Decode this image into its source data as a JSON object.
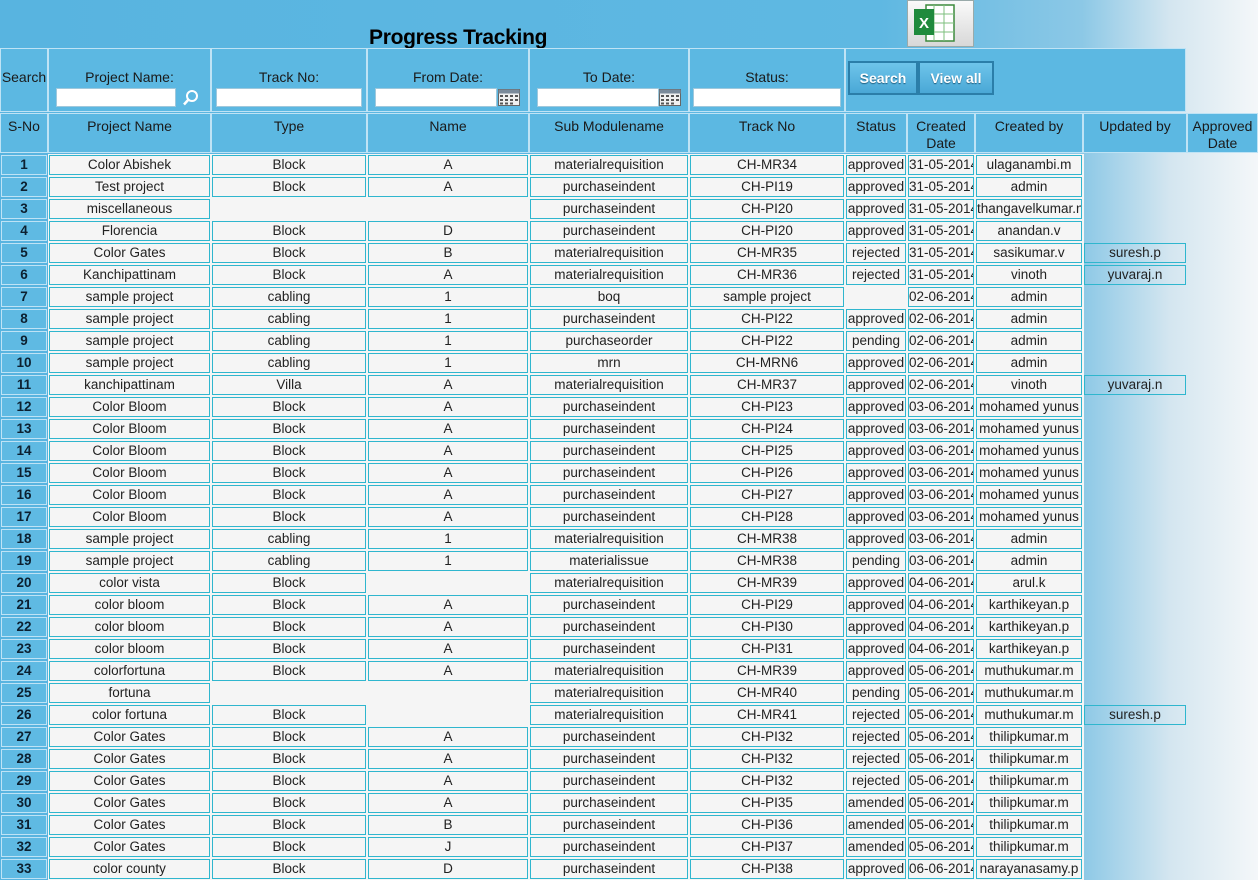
{
  "title": "Progress Tracking",
  "excel_icon": "excel-export-icon",
  "search": {
    "label": "Search",
    "project_name_label": "Project Name:",
    "track_no_label": "Track No:",
    "from_date_label": "From Date:",
    "to_date_label": "To Date:",
    "status_label": "Status:",
    "search_button": "Search",
    "view_all_button": "View all",
    "project_name_value": "",
    "track_no_value": "",
    "from_date_value": "",
    "to_date_value": "",
    "status_value": ""
  },
  "columns": [
    "S-No",
    "Project Name",
    "Type",
    "Name",
    "Sub Modulename",
    "Track No",
    "Status",
    "Created Date",
    "Created by",
    "Updated by",
    "Approved Date"
  ],
  "rows": [
    [
      "1",
      "Color Abishek",
      "Block",
      "A",
      "materialrequisition",
      "CH-MR34",
      "approved",
      "31-05-2014",
      "ulaganambi.m",
      ""
    ],
    [
      "2",
      "Test project",
      "Block",
      "A",
      "purchaseindent",
      "CH-PI19",
      "approved",
      "31-05-2014",
      "admin",
      ""
    ],
    [
      "3",
      "miscellaneous",
      "",
      "",
      "purchaseindent",
      "CH-PI20",
      "approved",
      "31-05-2014",
      "thangavelkumar.n",
      ""
    ],
    [
      "4",
      "Florencia",
      "Block",
      "D",
      "purchaseindent",
      "CH-PI20",
      "approved",
      "31-05-2014",
      "anandan.v",
      ""
    ],
    [
      "5",
      "Color Gates",
      "Block",
      "B",
      "materialrequisition",
      "CH-MR35",
      "rejected",
      "31-05-2014",
      "sasikumar.v",
      "suresh.p"
    ],
    [
      "6",
      "Kanchipattinam",
      "Block",
      "A",
      "materialrequisition",
      "CH-MR36",
      "rejected",
      "31-05-2014",
      "vinoth",
      "yuvaraj.n"
    ],
    [
      "7",
      "sample project",
      "cabling",
      "1",
      "boq",
      "sample project",
      "",
      "02-06-2014",
      "admin",
      ""
    ],
    [
      "8",
      "sample project",
      "cabling",
      "1",
      "purchaseindent",
      "CH-PI22",
      "approved",
      "02-06-2014",
      "admin",
      ""
    ],
    [
      "9",
      "sample project",
      "cabling",
      "1",
      "purchaseorder",
      "CH-PI22",
      "pending",
      "02-06-2014",
      "admin",
      ""
    ],
    [
      "10",
      "sample project",
      "cabling",
      "1",
      "mrn",
      "CH-MRN6",
      "approved",
      "02-06-2014",
      "admin",
      ""
    ],
    [
      "11",
      "kanchipattinam",
      "Villa",
      "A",
      "materialrequisition",
      "CH-MR37",
      "approved",
      "02-06-2014",
      "vinoth",
      "yuvaraj.n"
    ],
    [
      "12",
      "Color Bloom",
      "Block",
      "A",
      "purchaseindent",
      "CH-PI23",
      "approved",
      "03-06-2014",
      "mohamed yunus",
      ""
    ],
    [
      "13",
      "Color Bloom",
      "Block",
      "A",
      "purchaseindent",
      "CH-PI24",
      "approved",
      "03-06-2014",
      "mohamed yunus",
      ""
    ],
    [
      "14",
      "Color Bloom",
      "Block",
      "A",
      "purchaseindent",
      "CH-PI25",
      "approved",
      "03-06-2014",
      "mohamed yunus",
      ""
    ],
    [
      "15",
      "Color Bloom",
      "Block",
      "A",
      "purchaseindent",
      "CH-PI26",
      "approved",
      "03-06-2014",
      "mohamed yunus",
      ""
    ],
    [
      "16",
      "Color Bloom",
      "Block",
      "A",
      "purchaseindent",
      "CH-PI27",
      "approved",
      "03-06-2014",
      "mohamed yunus",
      ""
    ],
    [
      "17",
      "Color Bloom",
      "Block",
      "A",
      "purchaseindent",
      "CH-PI28",
      "approved",
      "03-06-2014",
      "mohamed yunus",
      ""
    ],
    [
      "18",
      "sample project",
      "cabling",
      "1",
      "materialrequisition",
      "CH-MR38",
      "approved",
      "03-06-2014",
      "admin",
      ""
    ],
    [
      "19",
      "sample project",
      "cabling",
      "1",
      "materialissue",
      "CH-MR38",
      "pending",
      "03-06-2014",
      "admin",
      ""
    ],
    [
      "20",
      "color vista",
      "Block",
      "",
      "materialrequisition",
      "CH-MR39",
      "approved",
      "04-06-2014",
      "arul.k",
      ""
    ],
    [
      "21",
      "color bloom",
      "Block",
      "A",
      "purchaseindent",
      "CH-PI29",
      "approved",
      "04-06-2014",
      "karthikeyan.p",
      ""
    ],
    [
      "22",
      "color bloom",
      "Block",
      "A",
      "purchaseindent",
      "CH-PI30",
      "approved",
      "04-06-2014",
      "karthikeyan.p",
      ""
    ],
    [
      "23",
      "color bloom",
      "Block",
      "A",
      "purchaseindent",
      "CH-PI31",
      "approved",
      "04-06-2014",
      "karthikeyan.p",
      ""
    ],
    [
      "24",
      "colorfortuna",
      "Block",
      "A",
      "materialrequisition",
      "CH-MR39",
      "approved",
      "05-06-2014",
      "muthukumar.m",
      ""
    ],
    [
      "25",
      "fortuna",
      "",
      "",
      "materialrequisition",
      "CH-MR40",
      "pending",
      "05-06-2014",
      "muthukumar.m",
      ""
    ],
    [
      "26",
      "color fortuna",
      "Block",
      "",
      "materialrequisition",
      "CH-MR41",
      "rejected",
      "05-06-2014",
      "muthukumar.m",
      "suresh.p"
    ],
    [
      "27",
      "Color Gates",
      "Block",
      "A",
      "purchaseindent",
      "CH-PI32",
      "rejected",
      "05-06-2014",
      "thilipkumar.m",
      ""
    ],
    [
      "28",
      "Color Gates",
      "Block",
      "A",
      "purchaseindent",
      "CH-PI32",
      "rejected",
      "05-06-2014",
      "thilipkumar.m",
      ""
    ],
    [
      "29",
      "Color Gates",
      "Block",
      "A",
      "purchaseindent",
      "CH-PI32",
      "rejected",
      "05-06-2014",
      "thilipkumar.m",
      ""
    ],
    [
      "30",
      "Color Gates",
      "Block",
      "A",
      "purchaseindent",
      "CH-PI35",
      "amended",
      "05-06-2014",
      "thilipkumar.m",
      ""
    ],
    [
      "31",
      "Color Gates",
      "Block",
      "B",
      "purchaseindent",
      "CH-PI36",
      "amended",
      "05-06-2014",
      "thilipkumar.m",
      ""
    ],
    [
      "32",
      "Color Gates",
      "Block",
      "J",
      "purchaseindent",
      "CH-PI37",
      "amended",
      "05-06-2014",
      "thilipkumar.m",
      ""
    ],
    [
      "33",
      "color county",
      "Block",
      "D",
      "purchaseindent",
      "CH-PI38",
      "approved",
      "06-06-2014",
      "narayanasamy.p",
      ""
    ]
  ]
}
